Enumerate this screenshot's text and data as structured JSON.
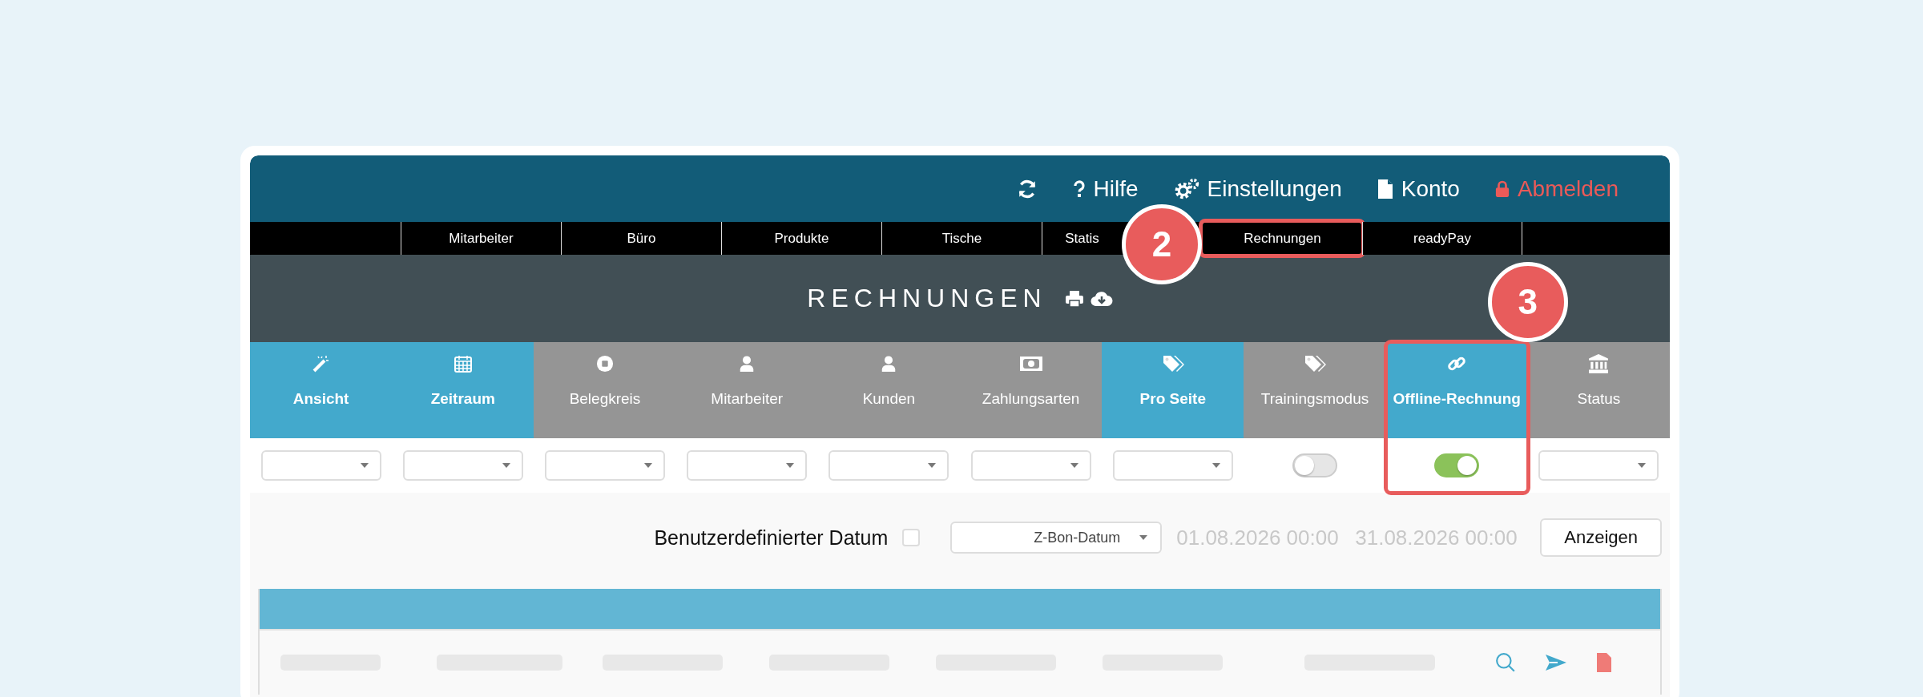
{
  "header": {
    "actions": [
      {
        "kind": "refresh"
      },
      {
        "kind": "help",
        "label": "Hilfe"
      },
      {
        "kind": "settings",
        "label": "Einstellungen"
      },
      {
        "kind": "account",
        "label": "Konto"
      },
      {
        "kind": "logout",
        "label": "Abmelden"
      }
    ]
  },
  "nav": [
    {
      "label": "Mitarbeiter",
      "highlighted": false
    },
    {
      "label": "Büro",
      "highlighted": false
    },
    {
      "label": "Produkte",
      "highlighted": false
    },
    {
      "label": "Tische",
      "highlighted": false
    },
    {
      "label": "Statis",
      "highlighted": false
    },
    {
      "label": "Rechnungen",
      "highlighted": true,
      "callout": "2"
    },
    {
      "label": "readyPay",
      "highlighted": false
    }
  ],
  "page_title": "RECHNUNGEN",
  "filters": [
    {
      "label": "Ansicht",
      "selected": true,
      "kind": "dropdown",
      "highlighted": false
    },
    {
      "label": "Zeitraum",
      "selected": true,
      "kind": "dropdown",
      "highlighted": false
    },
    {
      "label": "Belegkreis",
      "selected": false,
      "kind": "dropdown",
      "highlighted": false
    },
    {
      "label": "Mitarbeiter",
      "selected": false,
      "kind": "dropdown",
      "highlighted": false
    },
    {
      "label": "Kunden",
      "selected": false,
      "kind": "dropdown",
      "highlighted": false
    },
    {
      "label": "Zahlungsarten",
      "selected": false,
      "kind": "dropdown",
      "highlighted": false
    },
    {
      "label": "Pro Seite",
      "selected": true,
      "kind": "dropdown",
      "highlighted": false
    },
    {
      "label": "Trainingsmodus",
      "selected": false,
      "kind": "toggle",
      "on": false,
      "highlighted": false
    },
    {
      "label": "Offline-Rechnung",
      "selected": true,
      "kind": "toggle",
      "on": true,
      "highlighted": true,
      "callout": "3"
    },
    {
      "label": "Status",
      "selected": false,
      "kind": "dropdown",
      "highlighted": false
    }
  ],
  "date_filter": {
    "label": "Benutzerdefinierter Datum",
    "checked": false,
    "date_type": "Z-Bon-Datum",
    "from_placeholder": "01.08.2026 00:00",
    "to_placeholder": "31.08.2026 00:00",
    "button": "Anzeigen"
  }
}
